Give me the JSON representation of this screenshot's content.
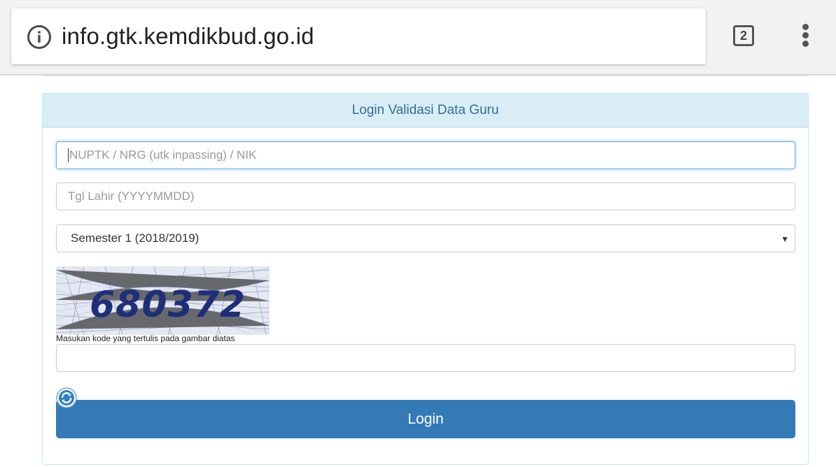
{
  "browser": {
    "url": "info.gtk.kemdikbud.go.id",
    "tab_count": "2"
  },
  "panel": {
    "heading": "Login Validasi Data Guru"
  },
  "form": {
    "id_placeholder": "NUPTK / NRG (utk inpassing) / NIK",
    "dob_placeholder": "Tgl Lahir (YYYYMMDD)",
    "semester_selected": "Semester 1 (2018/2019)",
    "captcha_code": "680372",
    "captcha_note": "Masukan kode yang tertulis pada gambar diatas",
    "captcha_value": "",
    "login_label": "Login"
  },
  "colors": {
    "panel_heading_bg": "#d9edf7",
    "panel_heading_text": "#31708f",
    "primary_button": "#337ab7",
    "focus_border": "#66afe9"
  }
}
